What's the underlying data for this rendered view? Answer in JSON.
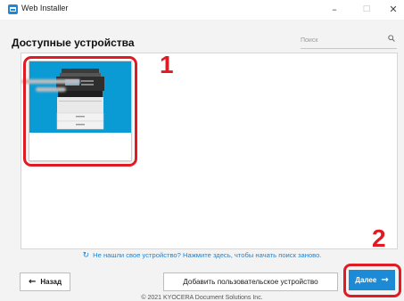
{
  "window": {
    "title": "Web Installer",
    "minimize_glyph": "–",
    "maximize_glyph": "□",
    "close_glyph": "✕"
  },
  "header": {
    "title": "Доступные устройства",
    "search_placeholder": "Поиск"
  },
  "devices": [
    {
      "name": "",
      "image_icon": "printer-icon"
    }
  ],
  "callouts": {
    "one": "1",
    "two": "2"
  },
  "rescan": {
    "icon": "↻",
    "text": "Не нашли свое устройство? Нажмите здесь, чтобы начать поиск заново."
  },
  "buttons": {
    "back_label": "Назад",
    "back_icon": "←",
    "add_label": "Добавить пользовательское устройство",
    "next_label": "Далее",
    "next_icon": "→"
  },
  "footer": {
    "copyright": "© 2021 KYOCERA Document Solutions Inc."
  },
  "colors": {
    "accent": "#1d8ad5",
    "device_tile": "#0b9bd4",
    "callout_red": "#e01b24",
    "link": "#1f84d6"
  }
}
